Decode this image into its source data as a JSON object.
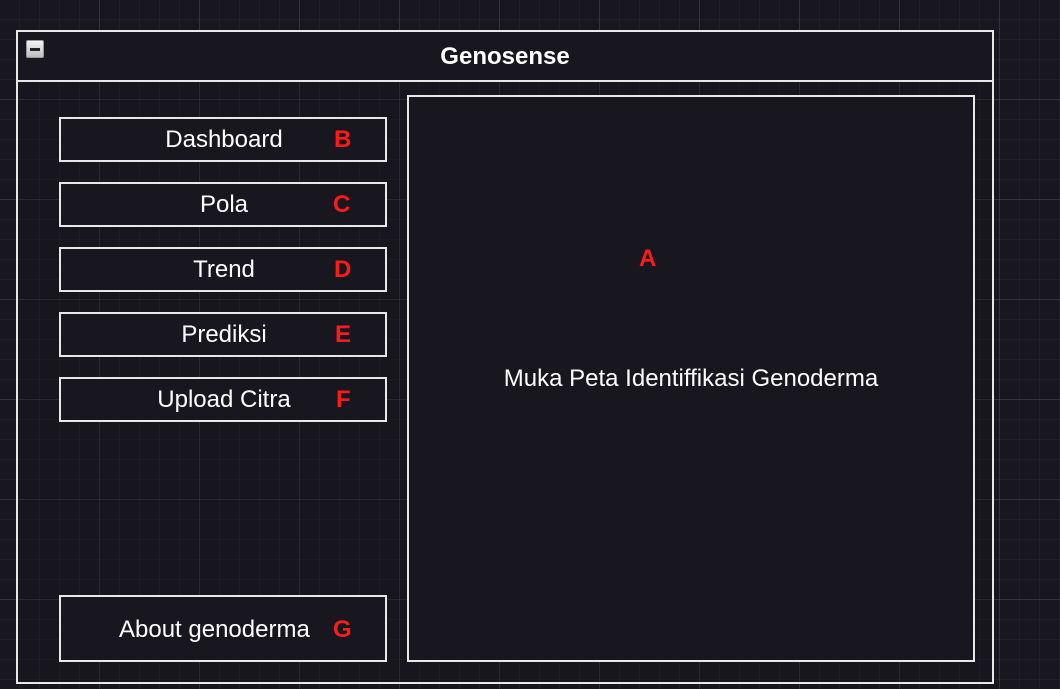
{
  "window": {
    "title": "Genosense",
    "minimize_icon": "minimize-icon"
  },
  "sidebar": {
    "items": [
      {
        "label": "Dashboard",
        "letter": "B"
      },
      {
        "label": "Pola",
        "letter": "C"
      },
      {
        "label": "Trend",
        "letter": "D"
      },
      {
        "label": "Prediksi",
        "letter": "E"
      },
      {
        "label": "Upload Citra",
        "letter": "F"
      }
    ],
    "about": {
      "label": "About genoderma",
      "letter": "G"
    }
  },
  "map_panel": {
    "letter": "A",
    "label": "Muka Peta Identiffikasi Genoderma"
  },
  "colors": {
    "background": "#18161f",
    "border": "#e8e8e8",
    "text": "#ffffff",
    "annotation": "#ff1a1a"
  }
}
